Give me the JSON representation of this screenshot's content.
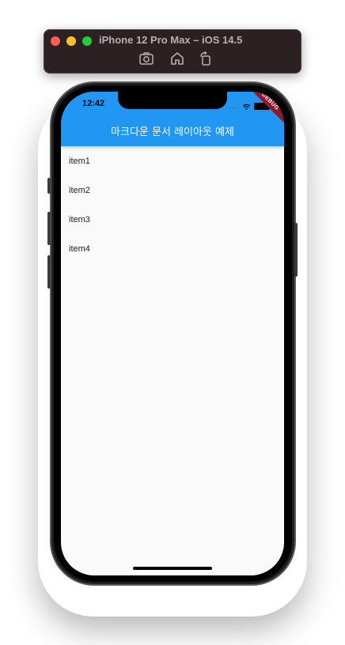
{
  "simulator": {
    "title": "iPhone 12 Pro Max – iOS 14.5",
    "toolbar_icons": [
      "screenshot-icon",
      "home-icon",
      "rotate-icon"
    ]
  },
  "status_bar": {
    "time": "12:42",
    "signal_text": "....",
    "debug_banner": "DEBUG"
  },
  "app_bar": {
    "title": "마크다운 문서 레이아웃 예제",
    "color": "#2196f3"
  },
  "list": {
    "items": [
      "item1",
      "item2",
      "item3",
      "item4"
    ]
  }
}
